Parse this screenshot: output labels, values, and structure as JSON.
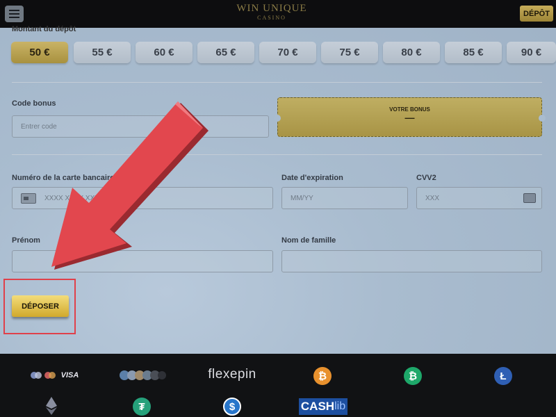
{
  "header": {
    "logo_text": "WIN UNIQUE",
    "logo_sub": "CASINO",
    "depot_label": "DÉPÔT"
  },
  "amount": {
    "label": "Montant du dépôt",
    "options": [
      "50 €",
      "55 €",
      "60 €",
      "65 €",
      "70 €",
      "75 €",
      "80 €",
      "85 €",
      "90 €"
    ],
    "selected": "50 €"
  },
  "bonus": {
    "label": "Code bonus",
    "placeholder": "Entrer code",
    "ticket_title": "VOTRE BONUS",
    "ticket_value": "—"
  },
  "card": {
    "number_label": "Numéro de la carte bancaire",
    "number_placeholder": "XXXX XXXX XXXX XXXX",
    "expiry_label": "Date d'expiration",
    "expiry_placeholder": "MM/YY",
    "cvv_label": "CVV2",
    "cvv_placeholder": "XXX"
  },
  "name": {
    "first_label": "Prénom",
    "last_label": "Nom de famille"
  },
  "submit": {
    "label": "DÉPOSER"
  },
  "footer": {
    "visa": "VISA",
    "flexepin": "flexepin",
    "cashlib_cash": "CASH",
    "cashlib_lib": "lib"
  },
  "colors": {
    "accent_gold": "#d1a92c",
    "highlight_red": "#e0404a",
    "arrow_red": "#e2474e"
  }
}
